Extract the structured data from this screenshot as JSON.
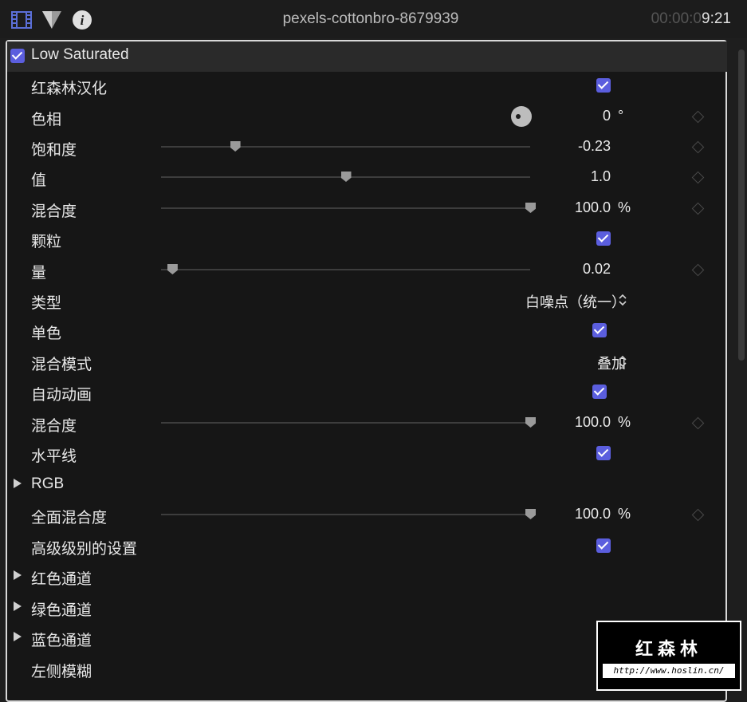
{
  "topbar": {
    "title": "pexels-cottonbro-8679939",
    "timecode_dim": "00:00:0",
    "timecode_bright": "9:21"
  },
  "effect": {
    "name": "Low Saturated",
    "enabled": true
  },
  "rows": {
    "localize": {
      "label": "红森林汉化",
      "checked": true
    },
    "hue": {
      "label": "色相",
      "value": "0",
      "unit": "°"
    },
    "saturation": {
      "label": "饱和度",
      "value": "-0.23",
      "slider_fraction": 0.2
    },
    "value": {
      "label": "值",
      "value": "1.0",
      "slider_fraction": 0.5
    },
    "mix1": {
      "label": "混合度",
      "value": "100.0",
      "unit": "%",
      "slider_fraction": 1.0
    },
    "grain": {
      "label": "颗粒",
      "checked": true
    },
    "amount": {
      "label": "量",
      "value": "0.02",
      "slider_fraction": 0.03
    },
    "type": {
      "label": "类型",
      "selected": "白噪点（统一）"
    },
    "mono": {
      "label": "单色",
      "checked": true
    },
    "blend_mode": {
      "label": "混合模式",
      "selected": "叠加"
    },
    "auto_animate": {
      "label": "自动动画",
      "checked": true
    },
    "mix2": {
      "label": "混合度",
      "value": "100.0",
      "unit": "%",
      "slider_fraction": 1.0
    },
    "horizontal": {
      "label": "水平线",
      "checked": true
    },
    "rgb": {
      "label": "RGB"
    },
    "global_mix": {
      "label": "全面混合度",
      "value": "100.0",
      "unit": "%",
      "slider_fraction": 1.0
    },
    "advanced": {
      "label": "高级级别的设置",
      "checked": true
    },
    "red": {
      "label": "红色通道"
    },
    "green": {
      "label": "绿色通道"
    },
    "blue": {
      "label": "蓝色通道"
    },
    "left_blur": {
      "label": "左侧模糊",
      "checked": true
    }
  },
  "watermark": {
    "title": "红森林",
    "url": "http://www.hoslin.cn/"
  },
  "colors": {
    "accent": "#5b5ede",
    "background": "#161616",
    "header": "#2a2a2a"
  },
  "icons": [
    "film-strip-icon",
    "filter-triangle-icon",
    "info-icon",
    "check-icon",
    "disclosure-triangle-icon",
    "keyframe-diamond-icon",
    "popup-arrows-icon",
    "hue-dial-icon"
  ]
}
